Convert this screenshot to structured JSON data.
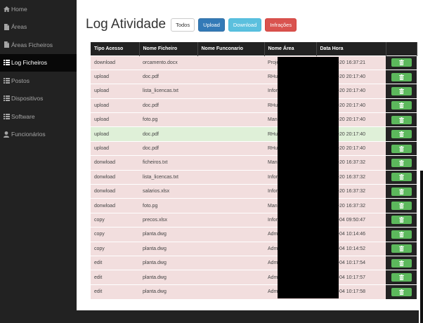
{
  "sidebar": {
    "items": [
      {
        "label": "Home",
        "icon": "home-icon",
        "active": false
      },
      {
        "label": "Áreas",
        "icon": "file-icon",
        "active": false
      },
      {
        "label": "Áreas Ficheiros",
        "icon": "file-icon",
        "active": false
      },
      {
        "label": "Log Ficheiros",
        "icon": "list-icon",
        "active": true
      },
      {
        "label": "Postos",
        "icon": "list-icon",
        "active": false
      },
      {
        "label": "Dispositivos",
        "icon": "list-icon",
        "active": false
      },
      {
        "label": "Software",
        "icon": "list-icon",
        "active": false
      },
      {
        "label": "Funcionários",
        "icon": "user-icon",
        "active": false
      }
    ]
  },
  "header": {
    "title": "Log Atividade",
    "buttons": [
      "Todos",
      "Upload",
      "Download",
      "Infrações"
    ]
  },
  "table": {
    "columns": [
      "Tipo Acesso",
      "Nome Ficheiro",
      "Nome Funconario",
      "Nome Área",
      "Data Hora",
      ""
    ],
    "rows": [
      {
        "tipo": "download",
        "ficheiro": "orcamento.docx",
        "area": "Projeto",
        "data": "2018-12-20 16:37:21",
        "status": "danger"
      },
      {
        "tipo": "upload",
        "ficheiro": "doc.pdf",
        "area": "RHumanos",
        "data": "2018-12-20 20:17:40",
        "status": "danger"
      },
      {
        "tipo": "upload",
        "ficheiro": "lista_licencas.txt",
        "area": "Informatica",
        "data": "2018-12-20 20:17:40",
        "status": "danger"
      },
      {
        "tipo": "upload",
        "ficheiro": "doc.pdf",
        "area": "RHumanos",
        "data": "2018-12-20 20:17:40",
        "status": "danger"
      },
      {
        "tipo": "upload",
        "ficheiro": "foto.pg",
        "area": "Manutencao",
        "data": "2018-12-20 20:17:40",
        "status": "danger"
      },
      {
        "tipo": "upload",
        "ficheiro": "doc.pdf",
        "area": "RHumanos",
        "data": "2018-12-20 20:17:40",
        "status": "success"
      },
      {
        "tipo": "upload",
        "ficheiro": "doc.pdf",
        "area": "RHumanos",
        "data": "2018-12-20 20:17:40",
        "status": "danger"
      },
      {
        "tipo": "donwload",
        "ficheiro": "ficheiros.txt",
        "area": "Manutencao",
        "data": "2018-12-20 16:37:32",
        "status": "danger"
      },
      {
        "tipo": "donwload",
        "ficheiro": "lista_licencas.txt",
        "area": "Informatica",
        "data": "2018-12-20 16:37:32",
        "status": "danger"
      },
      {
        "tipo": "donwload",
        "ficheiro": "salarios.xlsx",
        "area": "Informatica",
        "data": "2018-12-20 16:37:32",
        "status": "danger"
      },
      {
        "tipo": "donwload",
        "ficheiro": "foto.pg",
        "area": "Manutencao",
        "data": "2018-12-20 16:37:32",
        "status": "danger"
      },
      {
        "tipo": "copy",
        "ficheiro": "precos.xlsx",
        "area": "Informatica",
        "data": "2019-02-04 09:50:47",
        "status": "danger"
      },
      {
        "tipo": "copy",
        "ficheiro": "planta.dwg",
        "area": "Administracao",
        "data": "2019-02-04 10:14:46",
        "status": "danger"
      },
      {
        "tipo": "copy",
        "ficheiro": "planta.dwg",
        "area": "Administracao",
        "data": "2019-02-04 10:14:52",
        "status": "danger"
      },
      {
        "tipo": "edit",
        "ficheiro": "planta.dwg",
        "area": "Administracao",
        "data": "2019-02-04 10:17:54",
        "status": "danger"
      },
      {
        "tipo": "edit",
        "ficheiro": "planta.dwg",
        "area": "Administracao",
        "data": "2019-02-04 10:17:57",
        "status": "danger"
      },
      {
        "tipo": "edit",
        "ficheiro": "planta.dwg",
        "area": "Administracao",
        "data": "2019-02-04 10:17:58",
        "status": "danger"
      }
    ]
  },
  "colors": {
    "danger_row": "#f2dede",
    "success_row": "#dff0d8",
    "delete_button": "#5cb85c",
    "sidebar_bg": "#222222"
  }
}
